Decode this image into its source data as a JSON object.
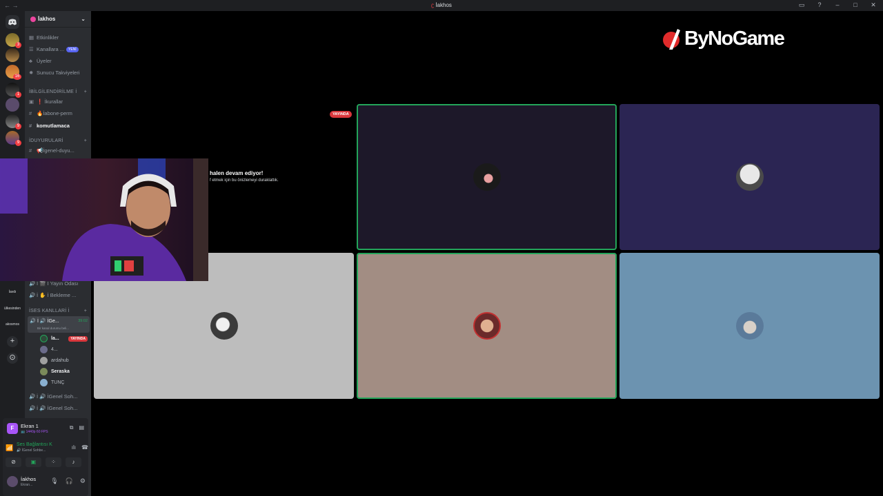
{
  "titlebar": {
    "nav": "← →",
    "title": "İakhos",
    "title_mark": "ʗ",
    "icons": [
      "inbox-icon",
      "help-icon",
      "minimize-icon",
      "maximize-icon",
      "close-icon"
    ]
  },
  "servers": {
    "badges": [
      "3",
      "16",
      "1",
      "9",
      "9"
    ],
    "text_items": [
      "İavdı",
      "ülkesinden",
      "akosmos"
    ],
    "add_icon": "+",
    "discover_icon": "⊙"
  },
  "guild": {
    "name": "İakhos",
    "chevron": "⌄"
  },
  "sidebar": {
    "top_items": [
      {
        "icon": "▦",
        "label": "Etkinlikler"
      },
      {
        "icon": "☰",
        "label": "Kanallara ...",
        "badge": "YENİ"
      },
      {
        "icon": "♣",
        "label": "Üyeler"
      },
      {
        "icon": "✹",
        "label": "Sunucu Takviyeleri"
      }
    ],
    "cat1": {
      "label": "İBİLGİLENDİRİLME İ",
      "plus": "+"
    },
    "text_channels": [
      {
        "icon": "▣",
        "label": "❗ İkurallar"
      },
      {
        "icon": "#",
        "label": "🔥İabone-perm"
      },
      {
        "icon": "#",
        "label": "komutlamaca"
      }
    ],
    "cat2": {
      "label": "İDUYURULARİ",
      "plus": "+"
    },
    "announce": {
      "icon": "#",
      "label": "📢İgenel-duyu..."
    },
    "voice_top": [
      {
        "icon": "🔊",
        "label": "İ 🎬 İ Yayın Odası"
      },
      {
        "icon": "🔊",
        "label": "İ ✋ İ Bekleme ..."
      }
    ],
    "cat3": {
      "label": "İSES KANLLARİ İ",
      "plus": "+"
    },
    "active_voice": {
      "label": "İ 🔊 İGe...",
      "time": "39:02",
      "status": "Bir kanal durumu beli..."
    },
    "voice_users": [
      {
        "name": "la...",
        "live": "YAYINDA",
        "bold": true
      },
      {
        "name": "4...",
        "live": "",
        "bold": false
      },
      {
        "name": "ardahub",
        "live": "",
        "bold": false
      },
      {
        "name": "Seraska",
        "live": "",
        "bold": true
      },
      {
        "name": "TUNÇ",
        "live": "",
        "bold": false
      }
    ],
    "voice_bottom": [
      {
        "icon": "🔊",
        "label": "İ 🔊 İGenel Soh..."
      },
      {
        "icon": "🔊",
        "label": "İ 🔊 İGenel Soh..."
      }
    ]
  },
  "panel": {
    "screen_initial": "F",
    "screen_title": "Ekran 1",
    "screen_sub": "📺 1440p 60 FPS",
    "voice_title": "Ses Bağlantısı K",
    "voice_sub": "🔊 İGenel Sohbe...",
    "user_name": "İakhos",
    "user_status": "Ekran..."
  },
  "stage": {
    "logo_text": "ByNoGame",
    "live_badge": "YAYINDA",
    "paused_title": "halen devam ediyor!",
    "paused_sub": "f etmek için bu önizlemeyi duraklattık."
  },
  "colors": {
    "accent": "#5865f2",
    "live": "#da373c",
    "speaking": "#23a55a",
    "tile1": "#1d1829",
    "tile2": "#2b2553",
    "tile3": "#bdbdbd",
    "tile4": "#a28d83",
    "tile5": "#6c93b0"
  }
}
